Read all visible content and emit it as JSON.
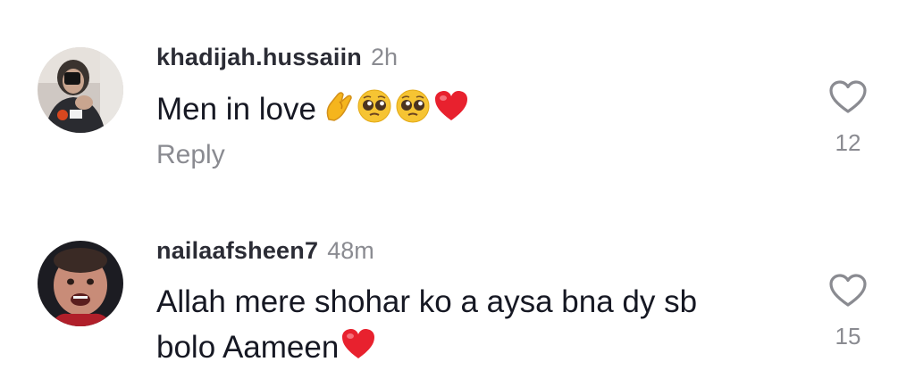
{
  "comments": [
    {
      "username": "khadijah.hussaiin",
      "time": "2h",
      "text": "Men in love",
      "emojis": [
        "pinching-hand-emoji",
        "pleading-face-emoji",
        "pleading-face-emoji",
        "red-heart-emoji"
      ],
      "reply_label": "Reply",
      "like_icon": "heart-outline-icon",
      "like_count": "12"
    },
    {
      "username": "nailaafsheen7",
      "time": "48m",
      "text_line1": "Allah mere shohar ko a aysa bna dy sb",
      "text_line2": "bolo Aameen",
      "emojis": [
        "red-heart-emoji"
      ],
      "like_icon": "heart-outline-icon",
      "like_count": "15"
    }
  ],
  "colors": {
    "username": "#2b2c35",
    "secondary_text": "#8a8b91",
    "body_text": "#161823",
    "heart_emoji": "#e8212e"
  }
}
